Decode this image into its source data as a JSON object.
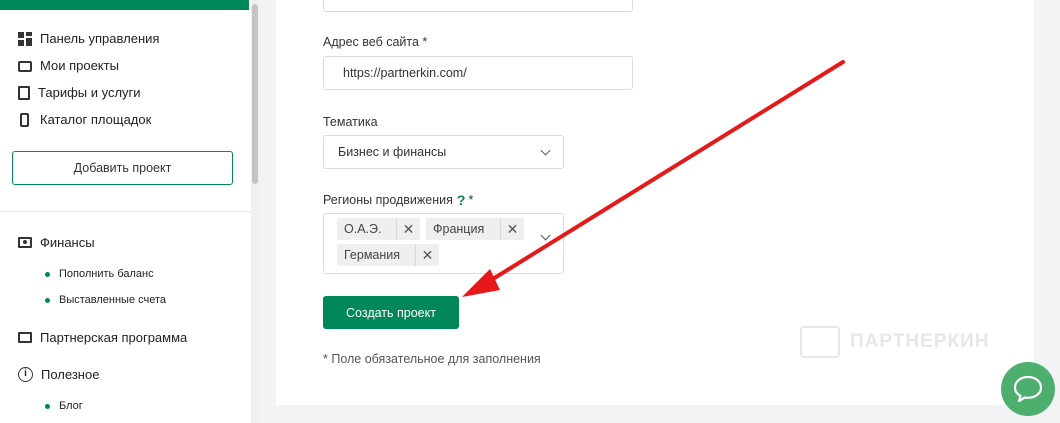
{
  "sidebar": {
    "nav": [
      {
        "label": "Панель управления",
        "icon": "dashboard-grid-icon"
      },
      {
        "label": "Мои проекты",
        "icon": "inbox-icon"
      },
      {
        "label": "Тарифы и услуги",
        "icon": "document-icon"
      },
      {
        "label": "Каталог площадок",
        "icon": "phone-icon"
      }
    ],
    "add_project_label": "Добавить проект",
    "finance": {
      "label": "Финансы",
      "icon": "money-icon"
    },
    "finance_items": [
      "Пополнить баланс",
      "Выставленные счета"
    ],
    "partner": {
      "label": "Партнерская программа",
      "icon": "partner-icon"
    },
    "useful": {
      "label": "Полезное",
      "icon": "info-icon"
    },
    "useful_items": [
      "Блог"
    ]
  },
  "form": {
    "website_label": "Адрес веб сайта *",
    "website_value": "https://partnerkin.com/",
    "theme_label": "Тематика",
    "theme_value": "Бизнес и финансы",
    "regions_label_prefix": "Регионы продвижения",
    "regions_help_icon": "?",
    "regions_label_suffix": "*",
    "regions": [
      "О.А.Э.",
      "Франция",
      "Германия"
    ],
    "tag_remove_glyph": "✕",
    "create_button_label": "Создать проект",
    "required_note": "* Поле обязательное для заполнения"
  },
  "watermark": {
    "text": "ПАРТНЕРКИН"
  },
  "chat": {
    "icon": "chat-bubble-icon"
  },
  "colors": {
    "brand": "#00875a",
    "annotation_arrow": "#e81818",
    "chat": "#4caf6e"
  }
}
